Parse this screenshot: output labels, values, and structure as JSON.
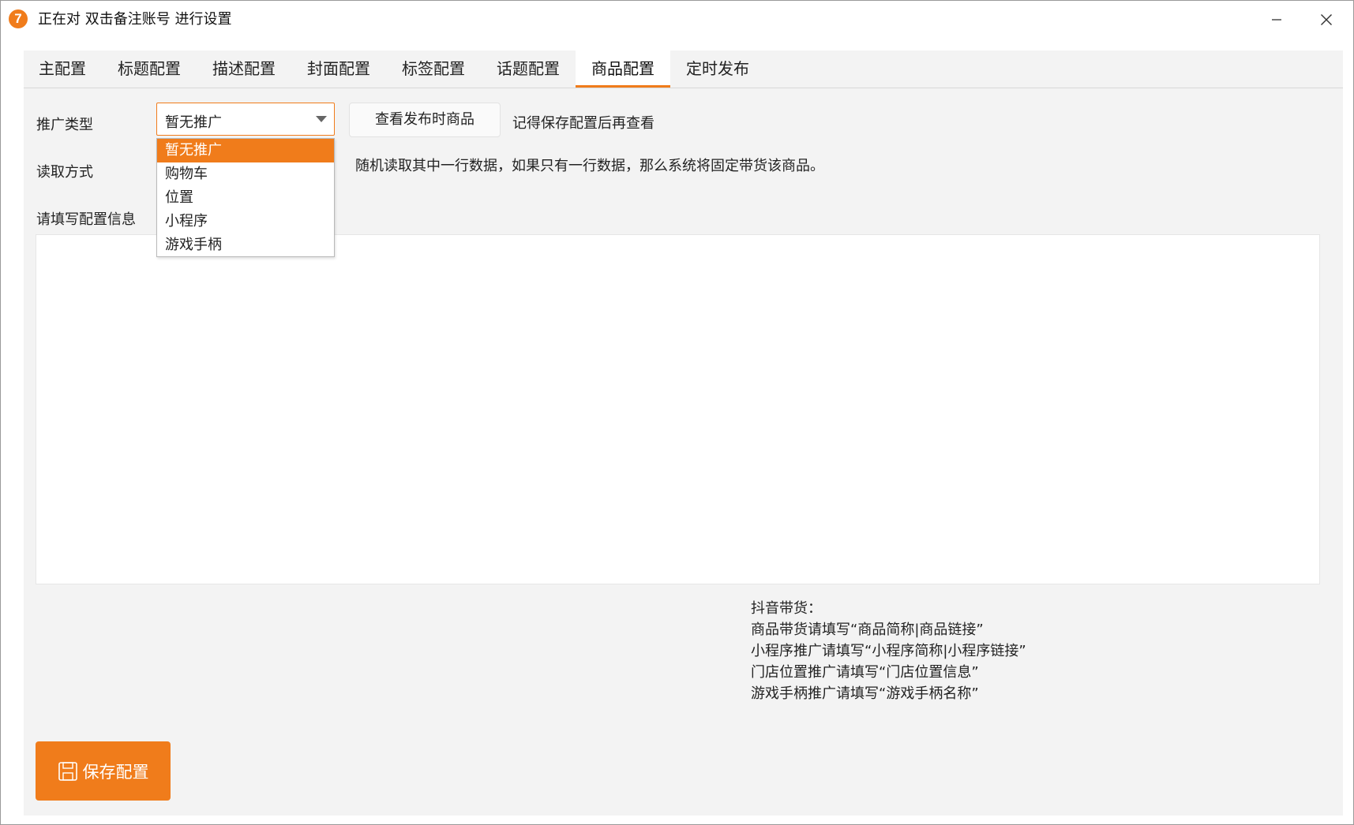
{
  "window": {
    "logo_text": "7",
    "title": "正在对 双击备注账号 进行设置",
    "accent_color": "#f07c1b"
  },
  "tabs": [
    {
      "label": "主配置",
      "active": false
    },
    {
      "label": "标题配置",
      "active": false
    },
    {
      "label": "描述配置",
      "active": false
    },
    {
      "label": "封面配置",
      "active": false
    },
    {
      "label": "标签配置",
      "active": false
    },
    {
      "label": "话题配置",
      "active": false
    },
    {
      "label": "商品配置",
      "active": true
    },
    {
      "label": "定时发布",
      "active": false
    }
  ],
  "form": {
    "promo_type_label": "推广类型",
    "promo_type_value": "暂无推广",
    "promo_type_options": [
      "暂无推广",
      "购物车",
      "位置",
      "小程序",
      "游戏手柄"
    ],
    "view_button_label": "查看发布时商品",
    "view_note": "记得保存配置后再查看",
    "read_mode_label": "读取方式",
    "read_mode_note": "随机读取其中一行数据，如果只有一行数据，那么系统将固定带货该商品。",
    "config_label": "请填写配置信息",
    "config_value": ""
  },
  "hints": [
    "抖音带货：",
    "商品带货请填写“商品简称|商品链接”",
    "小程序推广请填写“小程序简称|小程序链接”",
    "门店位置推广请填写“门店位置信息”",
    "游戏手柄推广请填写“游戏手柄名称”"
  ],
  "save_button_label": "保存配置"
}
